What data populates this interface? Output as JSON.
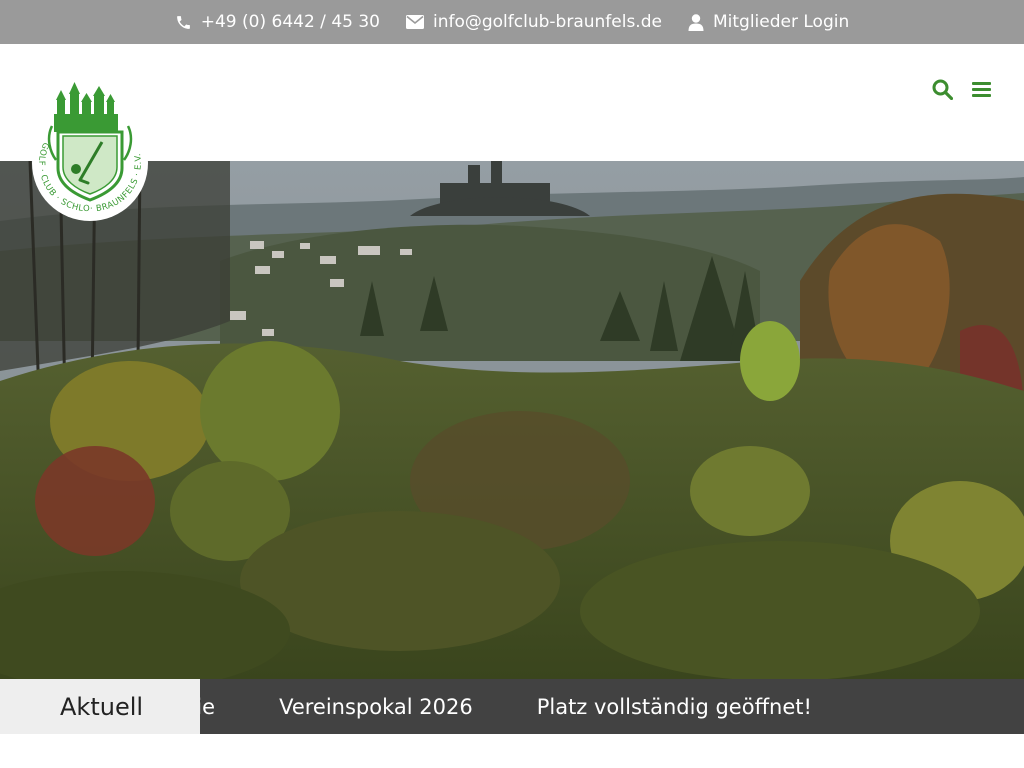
{
  "topbar": {
    "phone": "+49 (0) 6442 / 45 30",
    "email": "info@golfclub-braunfels.de",
    "login": "Mitglieder Login",
    "icons": [
      "phone-icon",
      "envelope-icon",
      "user-icon"
    ]
  },
  "header": {
    "logo_text": "GOLF CLUB SCHLOSS BRAUNFELS E.V.",
    "icons": [
      "search-icon",
      "menu-icon"
    ]
  },
  "ticker": {
    "label": "Aktuell",
    "items": [
      "nie",
      "Vereinspokal 2026",
      "Platz vollständig geöffnet!"
    ]
  },
  "colors": {
    "brand_green": "#3c8d2f",
    "topbar_gray": "#9a9a9a",
    "ticker_bg": "#424242",
    "ticker_label_bg": "#eeeeee"
  }
}
